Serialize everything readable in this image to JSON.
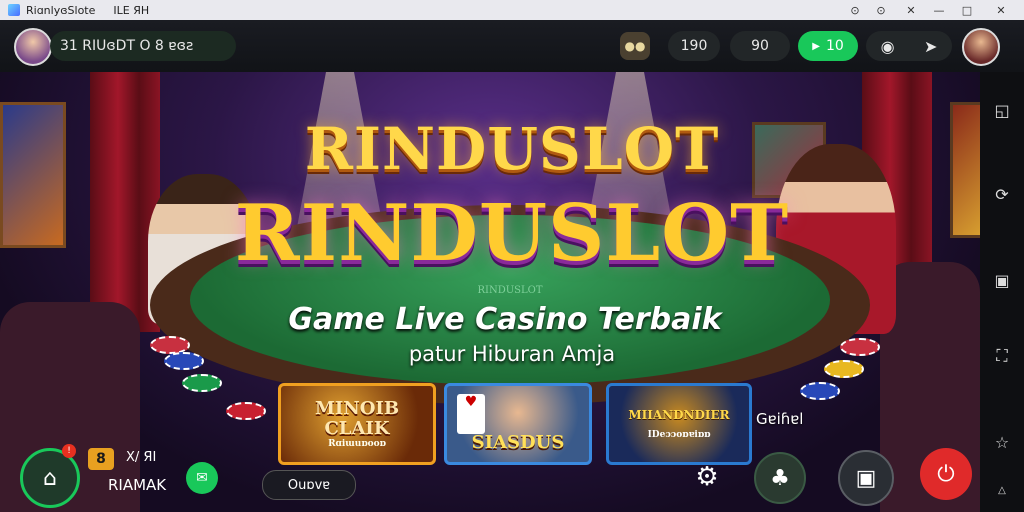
{
  "window": {
    "title": "RiɑnlyɞSlote",
    "menu": "ILE  ЯH",
    "controls": [
      "⊙",
      "⊙",
      "✕",
      "—",
      "□",
      "✕"
    ]
  },
  "player": {
    "name": "31 RIUɞDT  O  8 ɐɞƨ"
  },
  "topbar": {
    "balance_a": "190",
    "balance_b": "90",
    "coins": "10"
  },
  "hero": {
    "logo_top": "RINDUSLOT",
    "logo_main": "RINDUSLOT",
    "felt_text": "RINDUSLOT",
    "subtitle": "Game Live Casino Terbaik",
    "tagline": "patur Hiburan Amja"
  },
  "games": [
    {
      "title": "MINOIB CLAIK",
      "caption": "Rɑiɯuɒooɒ"
    },
    {
      "title": "SIASDUS",
      "caption": ""
    },
    {
      "title": "MIIANDNDIER",
      "caption": "IDeɔɔoɒɐiɒɒ"
    }
  ],
  "overlay_label": "Gɐiɦɐl",
  "bottom": {
    "badge_count": "8",
    "badge_label": "X/ ЯI",
    "user_label": "RIAMAK",
    "chat_label": "Ouɒvɐ"
  },
  "colors": {
    "accent_green": "#19c85a",
    "gold": "#ffd84a",
    "red_button": "#e02a2a"
  }
}
